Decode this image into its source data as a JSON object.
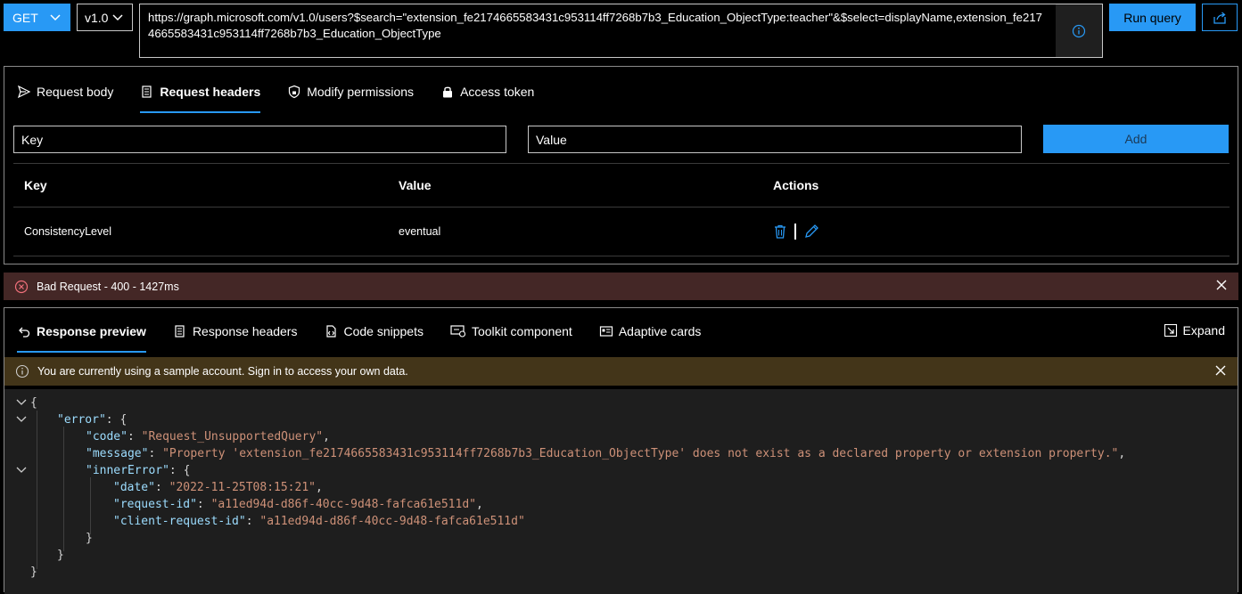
{
  "toolbar": {
    "method": "GET",
    "version": "v1.0",
    "url": "https://graph.microsoft.com/v1.0/users?$search=\"extension_fe2174665583431c953114ff7268b7b3_Education_ObjectType:teacher\"&$select=displayName,extension_fe2174665583431c953114ff7268b7b3_Education_ObjectType",
    "run_label": "Run query"
  },
  "request": {
    "tabs": [
      {
        "label": "Request body"
      },
      {
        "label": "Request headers"
      },
      {
        "label": "Modify permissions"
      },
      {
        "label": "Access token"
      }
    ],
    "key_placeholder": "Key",
    "value_placeholder": "Value",
    "add_label": "Add",
    "columns": {
      "key": "Key",
      "value": "Value",
      "actions": "Actions"
    },
    "rows": [
      {
        "key": "ConsistencyLevel",
        "value": "eventual"
      }
    ]
  },
  "status": {
    "text": "Bad Request - 400 - 1427ms"
  },
  "response": {
    "tabs": [
      {
        "label": "Response preview"
      },
      {
        "label": "Response headers"
      },
      {
        "label": "Code snippets"
      },
      {
        "label": "Toolkit component"
      },
      {
        "label": "Adaptive cards"
      }
    ],
    "expand_label": "Expand",
    "warning": "You are currently using a sample account. Sign in to access your own data.",
    "json": {
      "error_key": "\"error\"",
      "code_key": "\"code\"",
      "code_val": "\"Request_UnsupportedQuery\"",
      "message_key": "\"message\"",
      "message_val": "\"Property 'extension_fe2174665583431c953114ff7268b7b3_Education_ObjectType' does not exist as a declared property or extension property.\"",
      "inner_key": "\"innerError\"",
      "date_key": "\"date\"",
      "date_val": "\"2022-11-25T08:15:21\"",
      "reqid_key": "\"request-id\"",
      "reqid_val": "\"a11ed94d-d86f-40cc-9d48-fafca61e511d\"",
      "clientid_key": "\"client-request-id\"",
      "clientid_val": "\"a11ed94d-d86f-40cc-9d48-fafca61e511d\""
    }
  },
  "colors": {
    "accent": "#2899f5",
    "error_bar": "#442726",
    "warning_bar": "#433519",
    "json_key": "#9cdcfe",
    "json_string": "#ce9178"
  }
}
